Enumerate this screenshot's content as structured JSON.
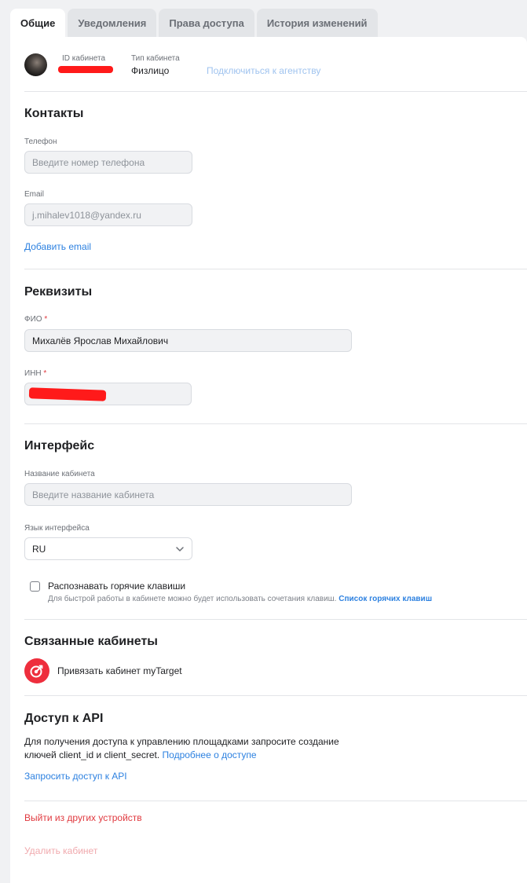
{
  "tabs": [
    {
      "label": "Общие",
      "active": true
    },
    {
      "label": "Уведомления",
      "active": false
    },
    {
      "label": "Права доступа",
      "active": false
    },
    {
      "label": "История изменений",
      "active": false
    }
  ],
  "account": {
    "id_label": "ID кабинета",
    "type_label": "Тип кабинета",
    "type_value": "Физлицо",
    "agency_link": "Подключиться к агентству"
  },
  "contacts": {
    "title": "Контакты",
    "phone_label": "Телефон",
    "phone_placeholder": "Введите номер телефона",
    "email_label": "Email",
    "email_value": "j.mihalev1018@yandex.ru",
    "add_email": "Добавить email"
  },
  "requisites": {
    "title": "Реквизиты",
    "fio_label": "ФИО",
    "fio_value": "Михалёв Ярослав Михайлович",
    "inn_label": "ИНН",
    "required_mark": "*"
  },
  "interface": {
    "title": "Интерфейс",
    "name_label": "Название кабинета",
    "name_placeholder": "Введите название кабинета",
    "lang_label": "Язык интерфейса",
    "lang_value": "RU",
    "hotkeys_label": "Распознавать горячие клавиши",
    "hotkeys_hint": "Для быстрой работы в кабинете можно будет использовать сочетания клавиш.",
    "hotkeys_link": "Список горячих клавиш",
    "hotkeys_checked": false
  },
  "linked": {
    "title": "Связанные кабинеты",
    "mytarget_label": "Привязать кабинет myTarget"
  },
  "api": {
    "title": "Доступ к API",
    "desc_line1": "Для получения доступа к управлению площадками запросите создание",
    "desc_line2": "ключей client_id и client_secret.",
    "more_link": "Подробнее о доступе",
    "request_link": "Запросить доступ к API"
  },
  "actions": {
    "logout_others": "Выйти из других устройств",
    "delete_account": "Удалить кабинет"
  },
  "colors": {
    "accent": "#2d81e0",
    "danger": "#e0393f",
    "mytarget": "#ee2e3d"
  }
}
